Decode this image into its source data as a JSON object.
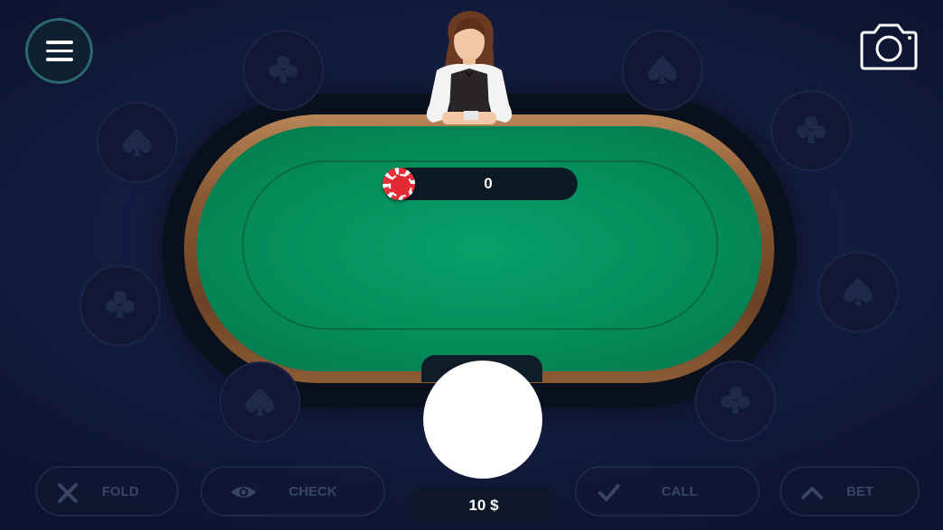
{
  "pot": {
    "value": "0"
  },
  "player": {
    "label": "-",
    "stack": "10 $"
  },
  "actions": {
    "fold": "FOLD",
    "check": "CHECK",
    "call": "CALL",
    "bet": "BET"
  },
  "colors": {
    "felt": "#058a5a",
    "rail": "#8a5a33",
    "background": "#151f44",
    "menu_border": "#2d6870",
    "chip": "#e42a33"
  },
  "icons": {
    "menu": "hamburger-icon",
    "camera": "camera-icon",
    "fold": "x-icon",
    "check": "eye-icon",
    "call": "checkmark-icon",
    "bet": "chevron-up-icon",
    "seat_suits": [
      "club",
      "spade",
      "spade",
      "club",
      "club",
      "spade",
      "spade",
      "club"
    ]
  }
}
